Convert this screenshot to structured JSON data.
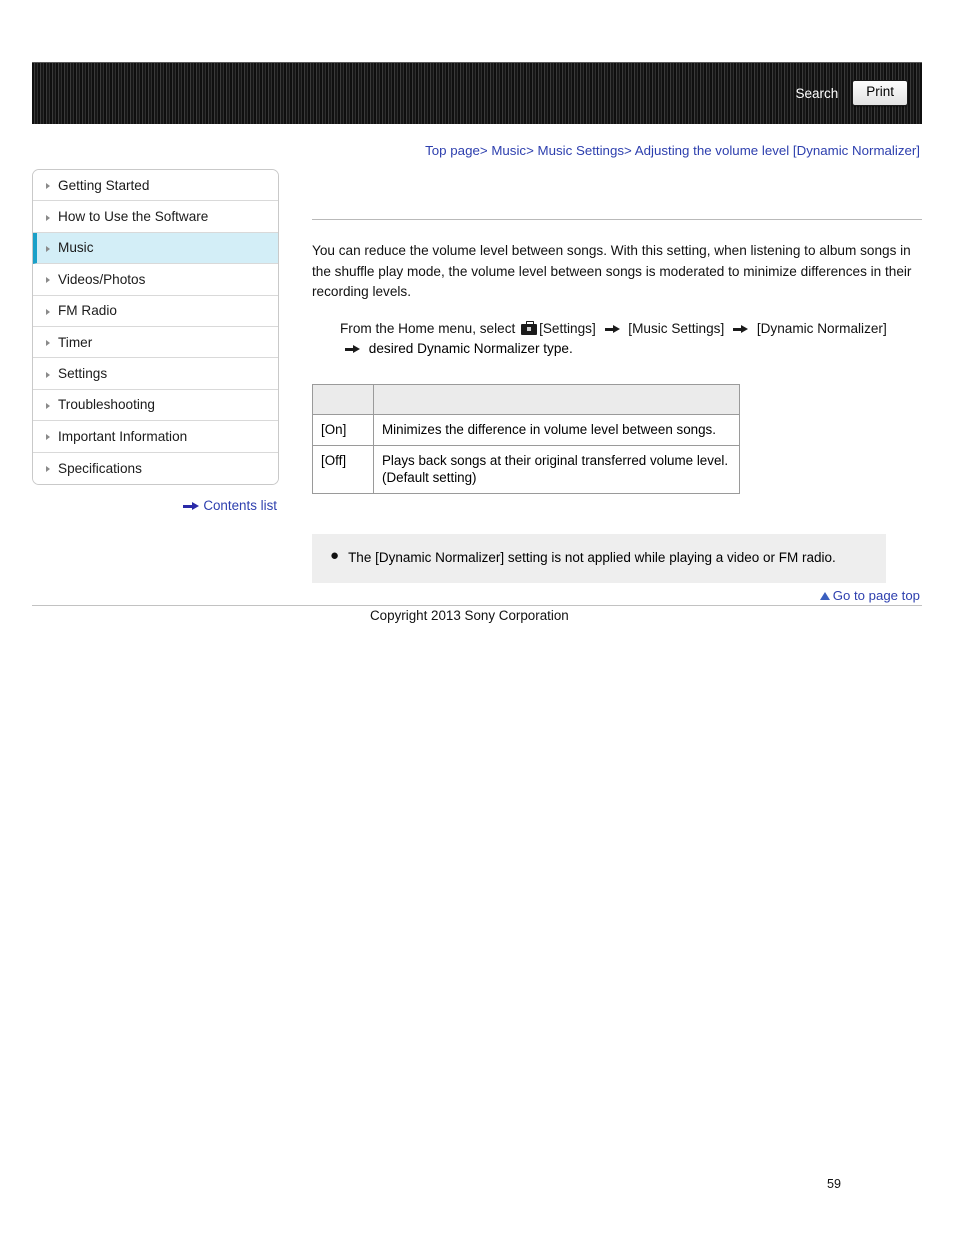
{
  "header": {
    "search_label": "Search",
    "print_label": "Print"
  },
  "breadcrumb": {
    "items": [
      {
        "label": "Top page"
      },
      {
        "label": "Music"
      },
      {
        "label": "Music Settings"
      },
      {
        "label": "Adjusting the volume level [Dynamic Normalizer]"
      }
    ],
    "separator": ">"
  },
  "sidebar": {
    "items": [
      {
        "label": "Getting Started",
        "active": false
      },
      {
        "label": "How to Use the Software",
        "active": false
      },
      {
        "label": "Music",
        "active": true
      },
      {
        "label": "Videos/Photos",
        "active": false
      },
      {
        "label": "FM Radio",
        "active": false
      },
      {
        "label": "Timer",
        "active": false
      },
      {
        "label": "Settings",
        "active": false
      },
      {
        "label": "Troubleshooting",
        "active": false
      },
      {
        "label": "Important Information",
        "active": false
      },
      {
        "label": "Specifications",
        "active": false
      }
    ],
    "contents_list_label": "Contents list"
  },
  "main": {
    "intro": "You can reduce the volume level between songs. With this setting, when listening to album songs in the shuffle play mode, the volume level between songs is moderated to minimize differences in their recording levels.",
    "step_prefix": "From the Home menu, select",
    "step_settings": "[Settings]",
    "step_music_settings": "[Music Settings]",
    "step_dynamic_normalizer": "[Dynamic Normalizer]",
    "step_line2": "desired Dynamic Normalizer type.",
    "table": {
      "header": [
        "",
        ""
      ],
      "rows": [
        {
          "key": "[On]",
          "desc": "Minimizes the difference in volume level between songs."
        },
        {
          "key": "[Off]",
          "desc": "Plays back songs at their original transferred volume level. (Default setting)"
        }
      ]
    },
    "note": "The [Dynamic Normalizer] setting is not applied while playing a video or FM radio.",
    "go_to_top": "Go to page top"
  },
  "footer": {
    "copyright": "Copyright 2013 Sony Corporation",
    "page_number": "59"
  }
}
